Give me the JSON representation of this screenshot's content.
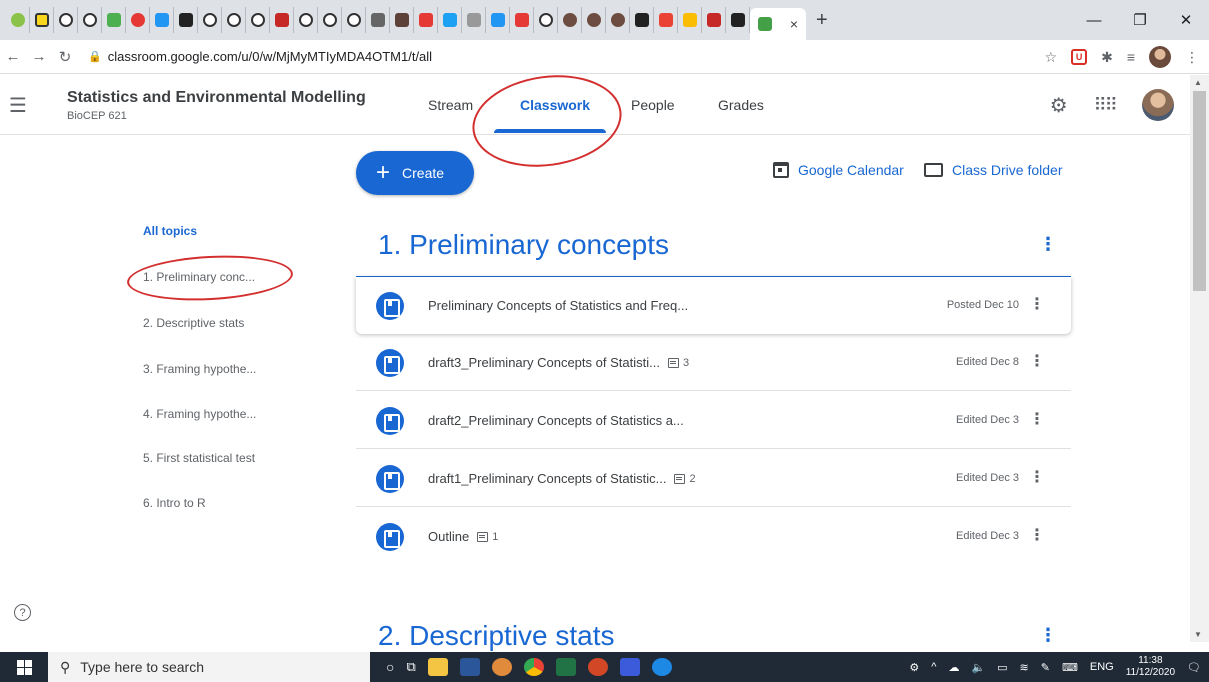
{
  "browser": {
    "address": "classroom.google.com/u/0/w/MjMyMTIyMDA4OTM1/t/all",
    "tab_close": "×",
    "new_tab": "+"
  },
  "classroom": {
    "class_title": "Statistics and Environmental Modelling",
    "class_code": "BioCEP 621",
    "tabs": [
      "Stream",
      "Classwork",
      "People",
      "Grades"
    ],
    "active_tab": "Classwork"
  },
  "toolbar": {
    "create_label": "Create",
    "calendar_label": "Google Calendar",
    "drive_label": "Class Drive folder"
  },
  "topics": {
    "header": "All topics",
    "items": [
      "1. Preliminary conc...",
      "2. Descriptive stats",
      "3. Framing hypothe...",
      "4. Framing hypothe...",
      "5. First statistical test",
      "6. Intro to R"
    ]
  },
  "sections": [
    {
      "title": "1. Preliminary concepts",
      "items": [
        {
          "title": "Preliminary Concepts of Statistics and Freq...",
          "comments": "",
          "date": "Posted Dec 10"
        },
        {
          "title": "draft3_Preliminary Concepts of Statisti...",
          "comments": "3",
          "date": "Edited Dec 8"
        },
        {
          "title": "draft2_Preliminary Concepts of Statistics a...",
          "comments": "",
          "date": "Edited Dec 3"
        },
        {
          "title": "draft1_Preliminary Concepts of Statistic...",
          "comments": "2",
          "date": "Edited Dec 3"
        },
        {
          "title": "Outline",
          "comments": "1",
          "date": "Edited Dec 3"
        }
      ]
    },
    {
      "title": "2. Descriptive stats"
    }
  ],
  "taskbar": {
    "search_placeholder": "Type here to search",
    "language": "ENG",
    "time": "11:38",
    "date": "11/12/2020"
  },
  "colors": {
    "accent": "#1967d2",
    "annotation": "#d32f2f"
  }
}
